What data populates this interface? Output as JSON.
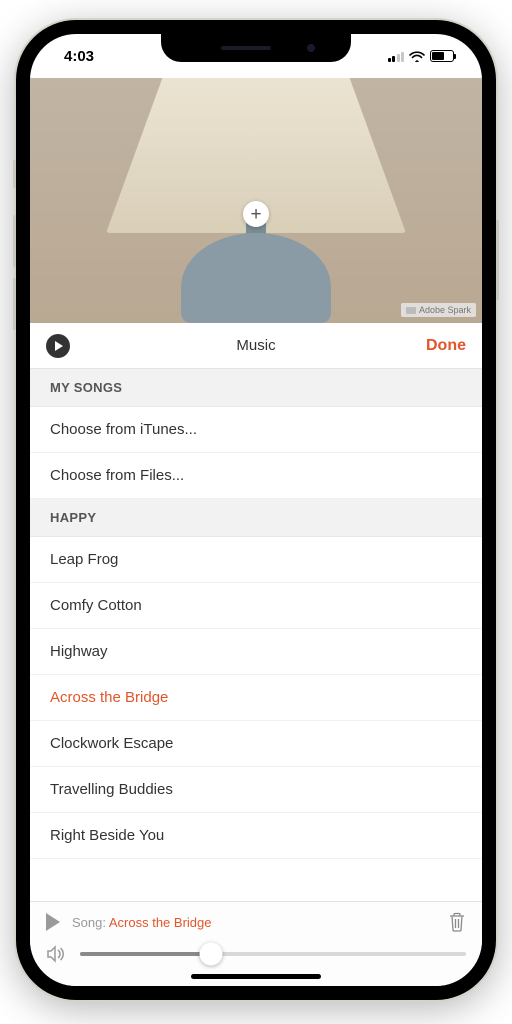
{
  "status": {
    "time": "4:03"
  },
  "image": {
    "watermark": "Adobe Spark"
  },
  "toolbar": {
    "title": "Music",
    "done": "Done"
  },
  "sections": {
    "mysongs": {
      "header": "MY SONGS",
      "items": [
        "Choose from iTunes...",
        "Choose from Files..."
      ]
    },
    "happy": {
      "header": "HAPPY",
      "items": [
        "Leap Frog",
        "Comfy Cotton",
        "Highway",
        "Across the Bridge",
        "Clockwork Escape",
        "Travelling Buddies",
        "Right Beside You"
      ],
      "selected": "Across the Bridge"
    }
  },
  "nowplaying": {
    "label": "Song: ",
    "song": "Across the Bridge"
  },
  "volume": {
    "percent": 34
  }
}
